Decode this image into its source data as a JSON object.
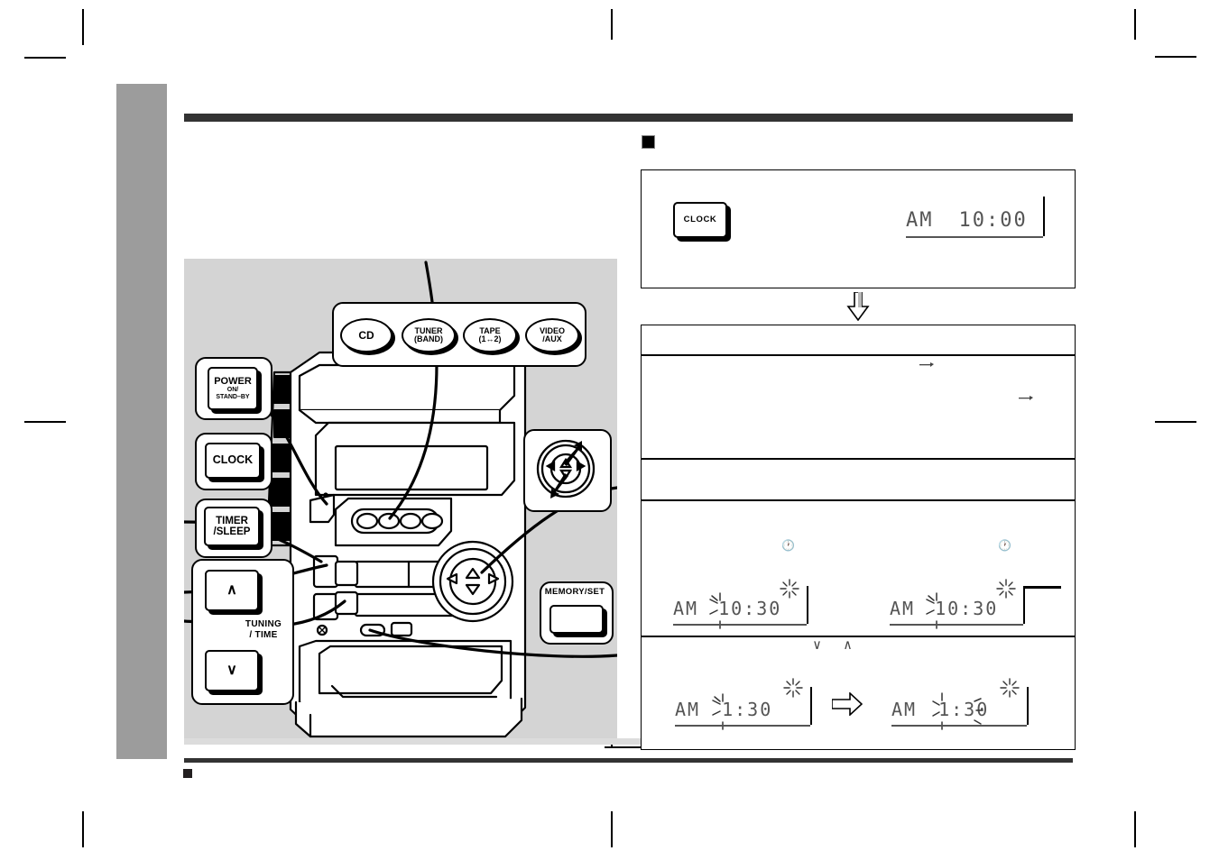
{
  "page": {
    "kind": "audio-system-instruction-manual-page",
    "section_bullet": "■",
    "footer_bullet": "■"
  },
  "illustration": {
    "caption_tuning": "TUNING\n/TIME",
    "source_buttons": [
      {
        "id": "cd",
        "line1": "CD",
        "line2": ""
      },
      {
        "id": "tuner",
        "line1": "TUNER",
        "line2": "(BAND)"
      },
      {
        "id": "tape",
        "line1": "TAPE",
        "line2": "(1↔2)"
      },
      {
        "id": "video_aux",
        "line1": "VIDEO",
        "line2": "/AUX"
      }
    ],
    "keys": [
      {
        "id": "power",
        "line1": "POWER",
        "line2": "ON/",
        "line3": "STAND–BY"
      },
      {
        "id": "clock",
        "line1": "CLOCK",
        "line2": "",
        "line3": ""
      },
      {
        "id": "timer_sleep",
        "line1": "TIMER",
        "line2": "/SLEEP",
        "line3": ""
      },
      {
        "id": "tuning_up",
        "line1": "∧",
        "line2": "",
        "line3": ""
      },
      {
        "id": "tuning_down",
        "line1": "∨",
        "line2": "",
        "line3": ""
      }
    ],
    "tuning_label_line1": "TUNING",
    "tuning_label_line2": "/ TIME",
    "memory_set_label": "MEMORY/SET",
    "jog_dial_name": "multi-jog-dial"
  },
  "steps": {
    "flow_arrow": "⇩",
    "panel1": {
      "button_label": "CLOCK",
      "display": {
        "meridiem": "AM",
        "time": "10:00"
      }
    },
    "panel2": {
      "rows": [
        {
          "id": "row-1",
          "content": ""
        },
        {
          "id": "row-2",
          "content": ""
        },
        {
          "id": "row-3",
          "content": ""
        },
        {
          "id": "row-4",
          "content": ""
        },
        {
          "id": "row-5",
          "content": ""
        }
      ],
      "displays": [
        {
          "id": "disp-a",
          "meridiem": "AM",
          "time": "10:30",
          "flash": "hour",
          "clock_icon": "🕐",
          "timer_icon": "✳"
        },
        {
          "id": "disp-b",
          "meridiem": "AM",
          "time": "10:30",
          "flash": "hour",
          "clock_icon": "🕐",
          "timer_icon": "✳"
        },
        {
          "id": "disp-c",
          "meridiem": "AM",
          "time": "1:30",
          "flash": "hour",
          "clock_icon": "",
          "timer_icon": "✳"
        },
        {
          "id": "disp-d",
          "meridiem": "AM",
          "time": "1:30",
          "flash": "minute",
          "clock_icon": "",
          "timer_icon": "✳"
        }
      ],
      "chevron_down": "∨",
      "chevron_up": "∧",
      "inline_arrow": "⇨"
    }
  }
}
